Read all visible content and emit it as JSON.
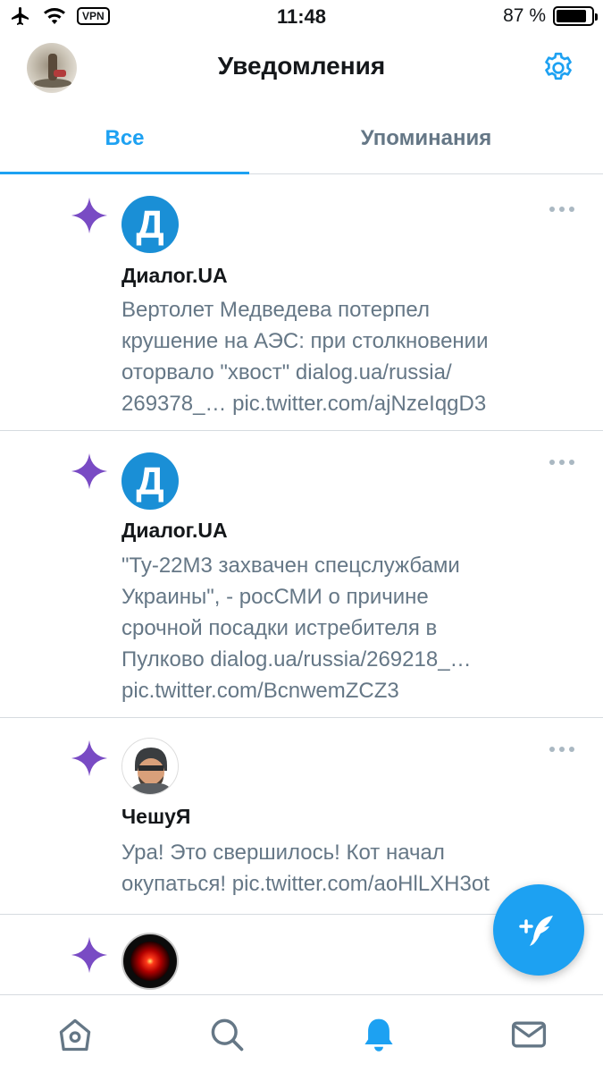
{
  "status_bar": {
    "vpn": "VPN",
    "time": "11:48",
    "battery_percent": "87 %",
    "battery_level": 0.87
  },
  "header": {
    "title": "Уведомления",
    "settings_icon": "gear-icon"
  },
  "tabs": [
    {
      "label": "Все",
      "active": true
    },
    {
      "label": "Упоминания",
      "active": false
    }
  ],
  "notifications": [
    {
      "icon": "sparkle-icon",
      "avatar_letter": "Д",
      "name": "Диалог.UA",
      "text": "Вертолет Медведева потерпел\nкрушение на АЭС: при столкновении\nоторвало \"хвост\"    dialog.ua/russia/\n269378_… pic.twitter.com/ajNzeIqgD3"
    },
    {
      "icon": "sparkle-icon",
      "avatar_letter": "Д",
      "name": "Диалог.UA",
      "text": "\"Ту-22М3 захвачен спецслужбами\nУкраины\", - росСМИ о причине\nсрочной посадки истребителя в\nПулково   dialog.ua/russia/269218_…\npic.twitter.com/BcnwemZCZ3"
    },
    {
      "icon": "sparkle-icon",
      "avatar_letter": "",
      "name": "ЧешуЯ",
      "text": "Ура! Это свершилось! Кот начал\nокупаться! pic.twitter.com/aoHlLXH3ot"
    },
    {
      "icon": "sparkle-icon",
      "avatar_letter": "",
      "name": "",
      "text": ""
    }
  ],
  "fab": {
    "icon": "compose-tweet-icon"
  },
  "bottom_nav": [
    {
      "icon": "home-icon"
    },
    {
      "icon": "search-icon"
    },
    {
      "icon": "bell-icon",
      "active": true
    },
    {
      "icon": "mail-icon"
    }
  ],
  "colors": {
    "accent": "#1da1f2",
    "sparkle": "#794bc4",
    "secondary_text": "#657786",
    "divider": "#d6dbe0"
  }
}
